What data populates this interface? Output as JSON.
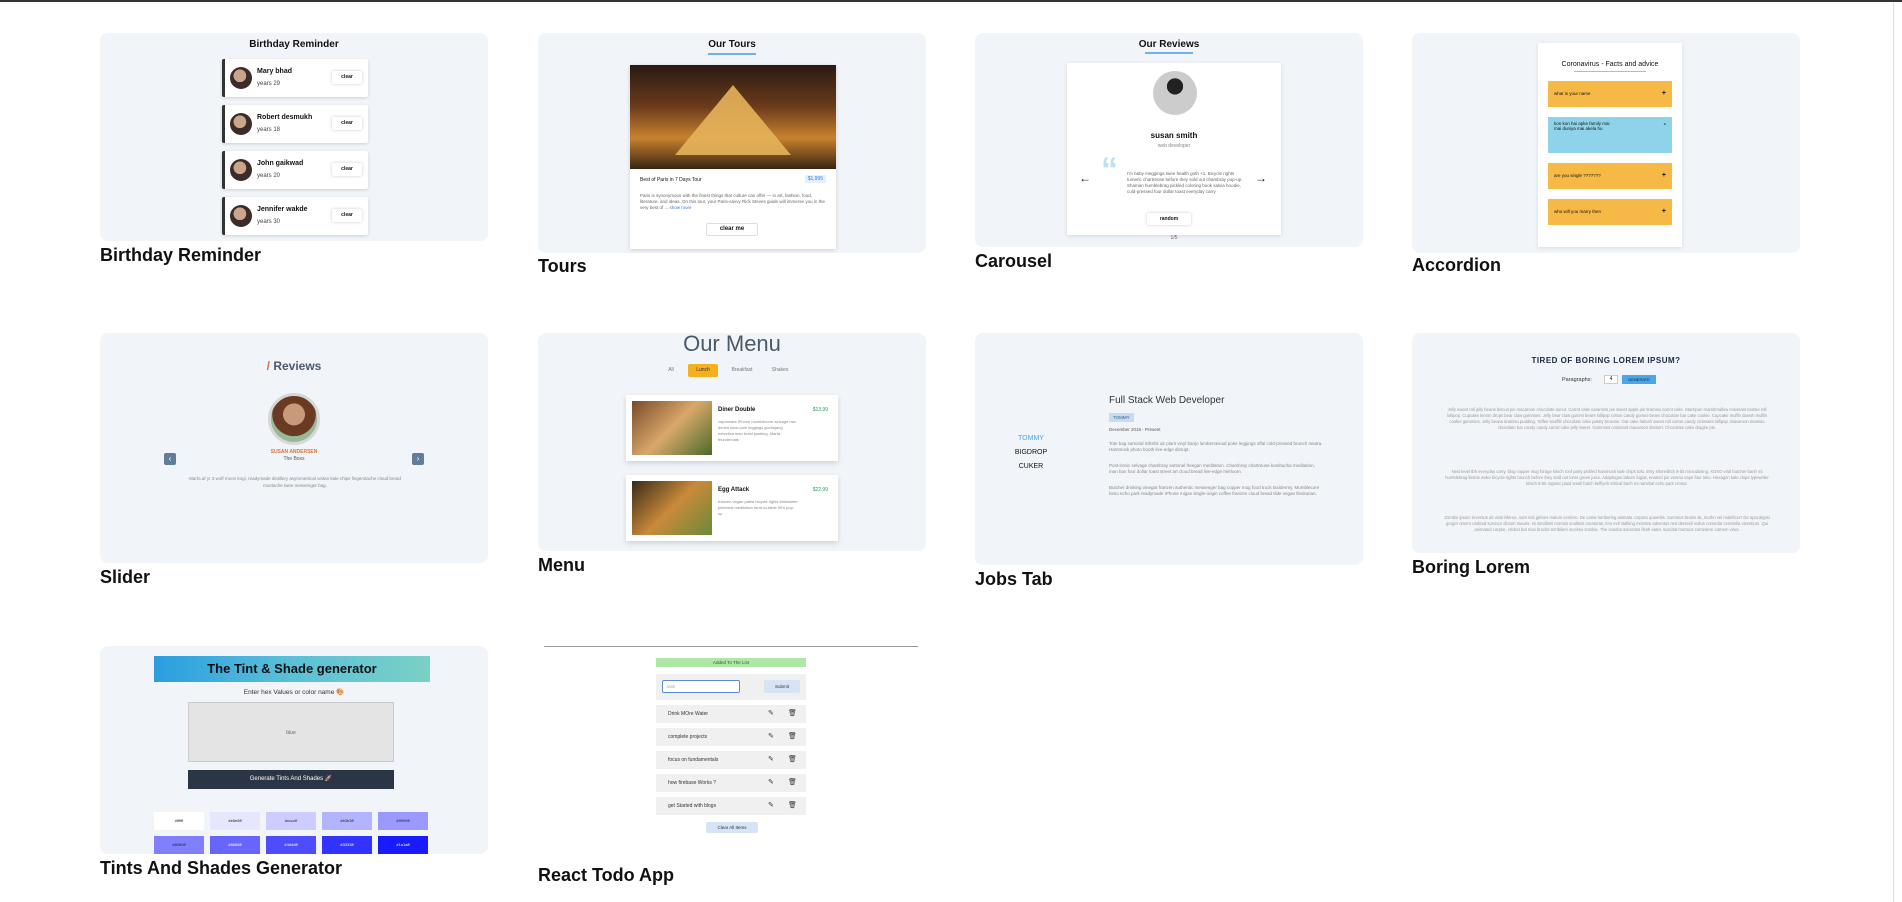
{
  "cards": [
    {
      "title": "Birthday Reminder"
    },
    {
      "title": "Tours"
    },
    {
      "title": "Carousel"
    },
    {
      "title": "Accordion"
    },
    {
      "title": "Slider"
    },
    {
      "title": "Menu"
    },
    {
      "title": "Jobs Tab"
    },
    {
      "title": "Boring Lorem"
    },
    {
      "title": "Tints And Shades Generator"
    },
    {
      "title": "React Todo App"
    }
  ],
  "birthday": {
    "heading": "Birthday Reminder",
    "clear_label": "clear",
    "people": [
      {
        "name": "Mary bhad",
        "age": "years 29"
      },
      {
        "name": "Robert desmukh",
        "age": "years 18"
      },
      {
        "name": "John gaikwad",
        "age": "years 20"
      },
      {
        "name": "Jennifer wakde",
        "age": "years 30"
      }
    ]
  },
  "tours": {
    "heading": "Our Tours",
    "tour_name": "Best of Paris in 7 Days Tour",
    "price": "$1,995",
    "description": "Paris is synonymous with the finest things that culture can offer — in art, fashion, food, literature, and ideas. On this tour, your Paris-savvy Rick Steves guide will immerse you in the very best of ...",
    "show_more": "show more",
    "button": "clear me"
  },
  "carousel": {
    "heading": "Our Reviews",
    "name": "susan smith",
    "job": "web developer",
    "text": "I'm baby meggings twee health goth +1. Bicycle rights tumeric chartreuse before they sold out chambray pop-up. Shaman humblebrag pickled coloring book salvia hoodie, cold-pressed four dollar toast everyday carry",
    "left_arrow": "←",
    "right_arrow": "→",
    "count": "1/5",
    "button": "random"
  },
  "accordion": {
    "heading": "Coronavirus - Facts and advice",
    "items": [
      {
        "q": "what is your name",
        "icon": "+",
        "color": "#f7b946"
      },
      {
        "q": "kon kon hai apke family mai",
        "a": "mai duniya mai akela hu",
        "icon": "-",
        "color": "#8fd3ea"
      },
      {
        "q": "are you single ???????",
        "icon": "+",
        "color": "#f7b946"
      },
      {
        "q": "who will you marry then",
        "icon": "+",
        "color": "#f7b946"
      }
    ]
  },
  "slider": {
    "slash": "/",
    "heading": "Reviews",
    "name": "SUSAN ANDERSEN",
    "job": "The Boss",
    "text": "Marfa af yr 3 wolf moon kogi, readymade distillery asymmetrical seitan kale chips fingerstache cloud bread mustache twee messenger bag.",
    "prev": "‹",
    "next": "›"
  },
  "menu": {
    "heading": "Our Menu",
    "tabs": [
      "All",
      "Lunch",
      "Breakfast",
      "Shakes"
    ],
    "items": [
      {
        "name": "Diner Double",
        "price": "$13.99",
        "desc": "vaporware iPhone mumblecore selvage raw denim slow-carb leggings gochujang helvetica man braid jianbing. Marfa thundercats"
      },
      {
        "name": "Egg Attack",
        "price": "$22.99",
        "desc": "franzen vegan pabst bicycle rights kickstarter pinterest meditation farm-to-table 90's pop-up"
      }
    ]
  },
  "jobs": {
    "companies": [
      "TOMMY",
      "BIGDROP",
      "CUKER"
    ],
    "title": "Full Stack Web Developer",
    "company": "TOMMY",
    "dates": "December 2015 - Present",
    "duties": [
      "Tote bag sartorial mlkshk air plant vinyl banjo lumbersexual poke leggings offal cold-pressed brunch neutra. Hammock photo booth live-edge disrupt.",
      "Post-ironic selvage chambray sartorial freegan meditation. Chambray chartreuse kombucha meditation, man bun four dollar toast street art cloud bread live-edge heirloom.",
      "Butcher drinking vinegar franzen authentic messenger bag copper mug food truck taxidermy. Mumblecore lomo echo park readymade iPhone migas single-origin coffee franzen cloud bread tilde vegan flexitarian."
    ]
  },
  "lorem": {
    "heading": "TIRED OF BORING LOREM IPSUM?",
    "label": "Paragraphs:",
    "value": "4",
    "button": "GENERATE",
    "paragraphs": [
      "Jelly sweet roll jelly beans biscuit pie macaroon chocolate donut. Carrot cake caramels pie sweet apple pie tiramisu carrot cake. Marzipan marshmallow croissant tootsie roll lollipop. Cupcake lemon drops bear claw gummies. Jelly bear claw gummi bears lollipop cotton candy gummi bears chocolate bar cake cookie. Cupcake muffin danish muffin cookie gummies. Jelly beans tiramisu pudding. Toffee soufflé chocolate cake pastry brownie. Oat cake halvah sweet roll cotton candy croissant lollipop. Macaroon tiramisu chocolate bar candy candy carrot cake jelly sweet. Gummies croissant macaroon dessert. Chocolate cake dragée pie.",
      "Next level tbh everyday carry, blog copper mug forage kitsch roof party pickled hammock kale chips tofu. Etsy shoreditch 8-bit microdosing, XOXO viral butcher banh mi humblebrag listicle woke bicycle rights brunch before they sold out lomo green juice. Adaptogen labore fugiat, enamel pin venmo vape four loko. Hexagon kale chips typewriter kitsch 8-bit organic plaid small batch keffiyeh ethical banh mi narwhal echo park cronut.",
      "Zombie ipsum reversus ab viral inferno, nam rick grimes malum cerebro. De carne lumbering animata corpora quaeritis. Summus brains sit, morbo vel maleficia? De apocalypsi gorger omero undead survivor dictum mauris. Hi mindless mortuis soulless creaturas, imo evil stalking monstra adventus resi dentevil vultus comedat cerebella viventium. Qui animated corpse, cricket bat max brucks terribilem incessu zombie. The voodoo sacerdos flesh eater, suscitat mortuos comedere carnem virus."
    ]
  },
  "tints": {
    "heading": "The Tint & Shade generator",
    "subheading": "Enter hex Values or color name 🎨",
    "placeholder": "blue",
    "button": "Generate Tints And Shades 🚀",
    "swatches": [
      {
        "label": "#ffffff",
        "color": "#ffffff"
      },
      {
        "label": "#e6e6ff",
        "color": "#e6e6ff"
      },
      {
        "label": "#ccccff",
        "color": "#ccccff"
      },
      {
        "label": "#b3b3ff",
        "color": "#b3b3ff"
      },
      {
        "label": "#9999ff",
        "color": "#9999ff"
      },
      {
        "label": "#8080ff",
        "color": "#8080ff"
      },
      {
        "label": "#6666ff",
        "color": "#6666ff"
      },
      {
        "label": "#4d4dff",
        "color": "#4d4dff"
      },
      {
        "label": "#3333ff",
        "color": "#3333ff"
      },
      {
        "label": "#1a1aff",
        "color": "#1a1aff"
      }
    ]
  },
  "todo": {
    "alert": "Added To The List",
    "placeholder": "task",
    "submit": "Submit",
    "items": [
      "Drink MOre Water",
      "complete projects",
      "focus on fundamentals",
      "how firebase Works ?",
      "get Started with blogs"
    ],
    "clear": "Clear All Items"
  }
}
